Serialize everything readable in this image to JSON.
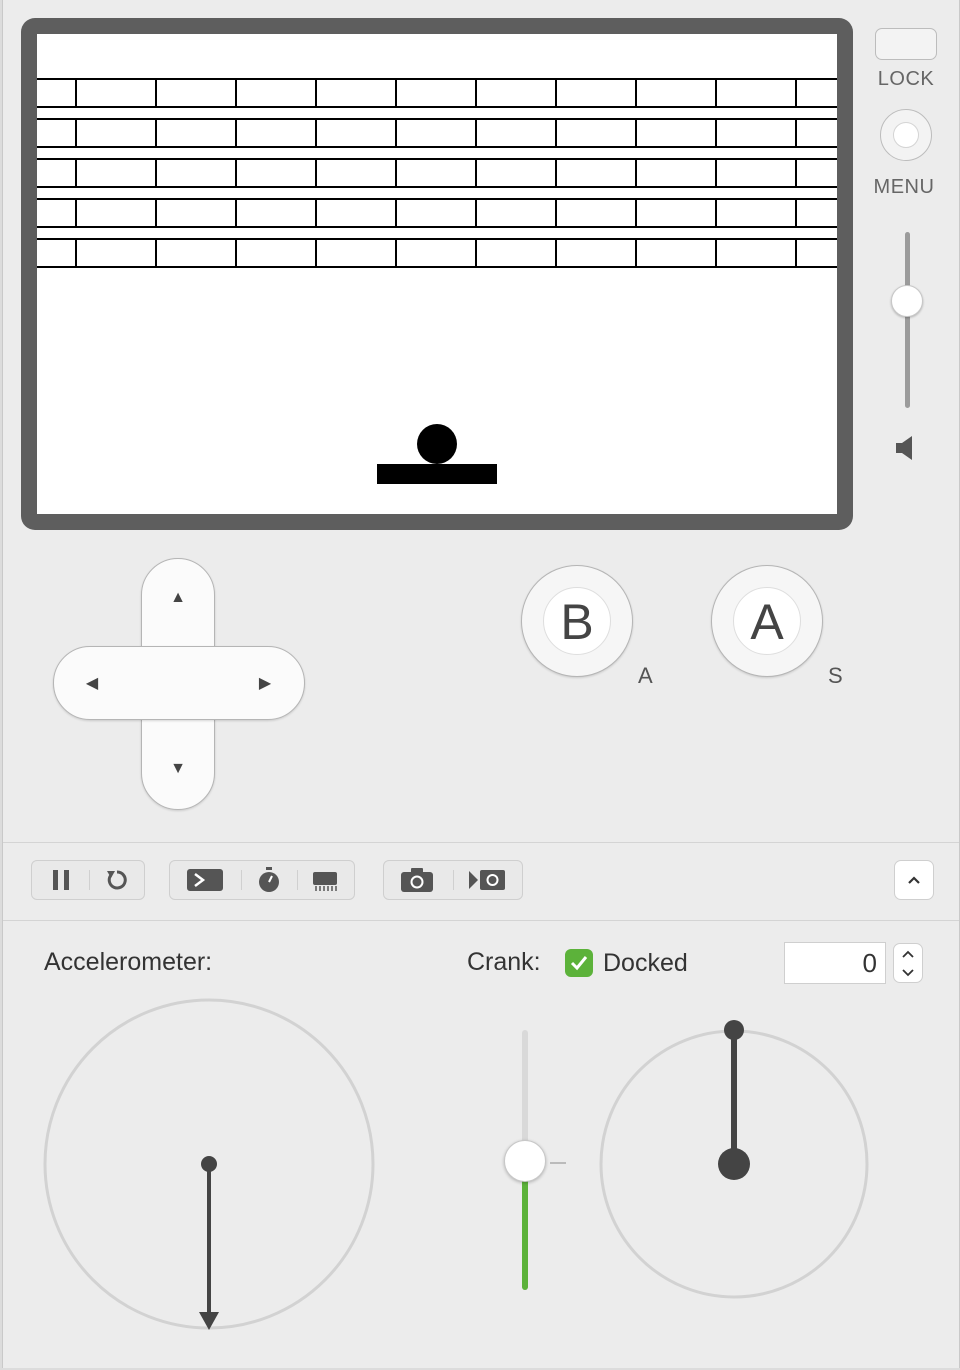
{
  "device": {
    "lock_label": "LOCK",
    "menu_label": "MENU",
    "volume_level": 0.6
  },
  "game_screen": {
    "brick_rows": 5,
    "bricks_per_row_visible": 11
  },
  "controls": {
    "dpad": {
      "up_icon": "▲",
      "down_icon": "▼",
      "left_icon": "◀",
      "right_icon": "▶"
    },
    "b_button": {
      "label": "B",
      "key_hint": "A"
    },
    "a_button": {
      "label": "A",
      "key_hint": "S"
    }
  },
  "toolbar": {
    "icons": [
      "pause-icon",
      "restart-icon",
      "console-icon",
      "stopwatch-icon",
      "memory-chip-icon",
      "camera-icon",
      "record-video-icon",
      "chevron-up-icon"
    ]
  },
  "simulator": {
    "accelerometer_label": "Accelerometer:",
    "crank_label": "Crank:",
    "docked_label": "Docked",
    "docked_checked": true,
    "crank_angle_value": "0"
  },
  "colors": {
    "accent_green": "#5cb23a",
    "bezel": "#5e5e5e",
    "window_bg": "#ececec"
  }
}
